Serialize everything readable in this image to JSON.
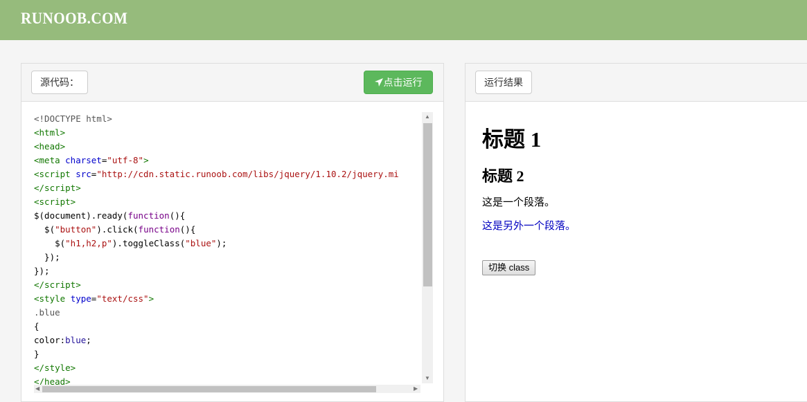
{
  "header": {
    "logo": "RUNOOB.COM",
    "brand_color": "#96bb7c"
  },
  "editor": {
    "title": "源代码：",
    "run_label": "点击运行",
    "run_icon": "paper-plane-icon",
    "lines": [
      [
        [
          "meta",
          "<!DOCTYPE html>"
        ]
      ],
      [
        [
          "tag",
          "<html>"
        ]
      ],
      [
        [
          "tag",
          "<head>"
        ]
      ],
      [
        [
          "tag",
          "<meta "
        ],
        [
          "attr",
          "charset"
        ],
        [
          "plain",
          "="
        ],
        [
          "str",
          "\"utf-8\""
        ],
        [
          "tag",
          ">"
        ]
      ],
      [
        [
          "tag",
          "<script "
        ],
        [
          "attr",
          "src"
        ],
        [
          "plain",
          "="
        ],
        [
          "str",
          "\"http://cdn.static.runoob.com/libs/jquery/1.10.2/jquery.mi"
        ]
      ],
      [
        [
          "tag",
          "</script>"
        ]
      ],
      [
        [
          "tag",
          "<script>"
        ]
      ],
      [
        [
          "plain",
          "$(document).ready("
        ],
        [
          "kw",
          "function"
        ],
        [
          "plain",
          "(){"
        ]
      ],
      [
        [
          "plain",
          "  $("
        ],
        [
          "str",
          "\"button\""
        ],
        [
          "plain",
          ").click("
        ],
        [
          "kw",
          "function"
        ],
        [
          "plain",
          "(){"
        ]
      ],
      [
        [
          "plain",
          "    $("
        ],
        [
          "str",
          "\"h1,h2,p\""
        ],
        [
          "plain",
          ").toggleClass("
        ],
        [
          "str",
          "\"blue\""
        ],
        [
          "plain",
          ");"
        ]
      ],
      [
        [
          "plain",
          "  });"
        ]
      ],
      [
        [
          "plain",
          "});"
        ]
      ],
      [
        [
          "tag",
          "</script>"
        ]
      ],
      [
        [
          "tag",
          "<style "
        ],
        [
          "attr",
          "type"
        ],
        [
          "plain",
          "="
        ],
        [
          "str",
          "\"text/css\""
        ],
        [
          "tag",
          ">"
        ]
      ],
      [
        [
          "q",
          ".blue"
        ]
      ],
      [
        [
          "plain",
          "{"
        ]
      ],
      [
        [
          "plain",
          "color:"
        ],
        [
          "atom",
          "blue"
        ],
        [
          "plain",
          ";"
        ]
      ],
      [
        [
          "plain",
          "}"
        ]
      ],
      [
        [
          "tag",
          "</style>"
        ]
      ],
      [
        [
          "tag",
          "</head>"
        ]
      ]
    ]
  },
  "result": {
    "title": "运行结果",
    "h1": "标题 1",
    "h2": "标题 2",
    "p1": "这是一个段落。",
    "p2": "这是另外一个段落。",
    "button": "切换 class"
  }
}
